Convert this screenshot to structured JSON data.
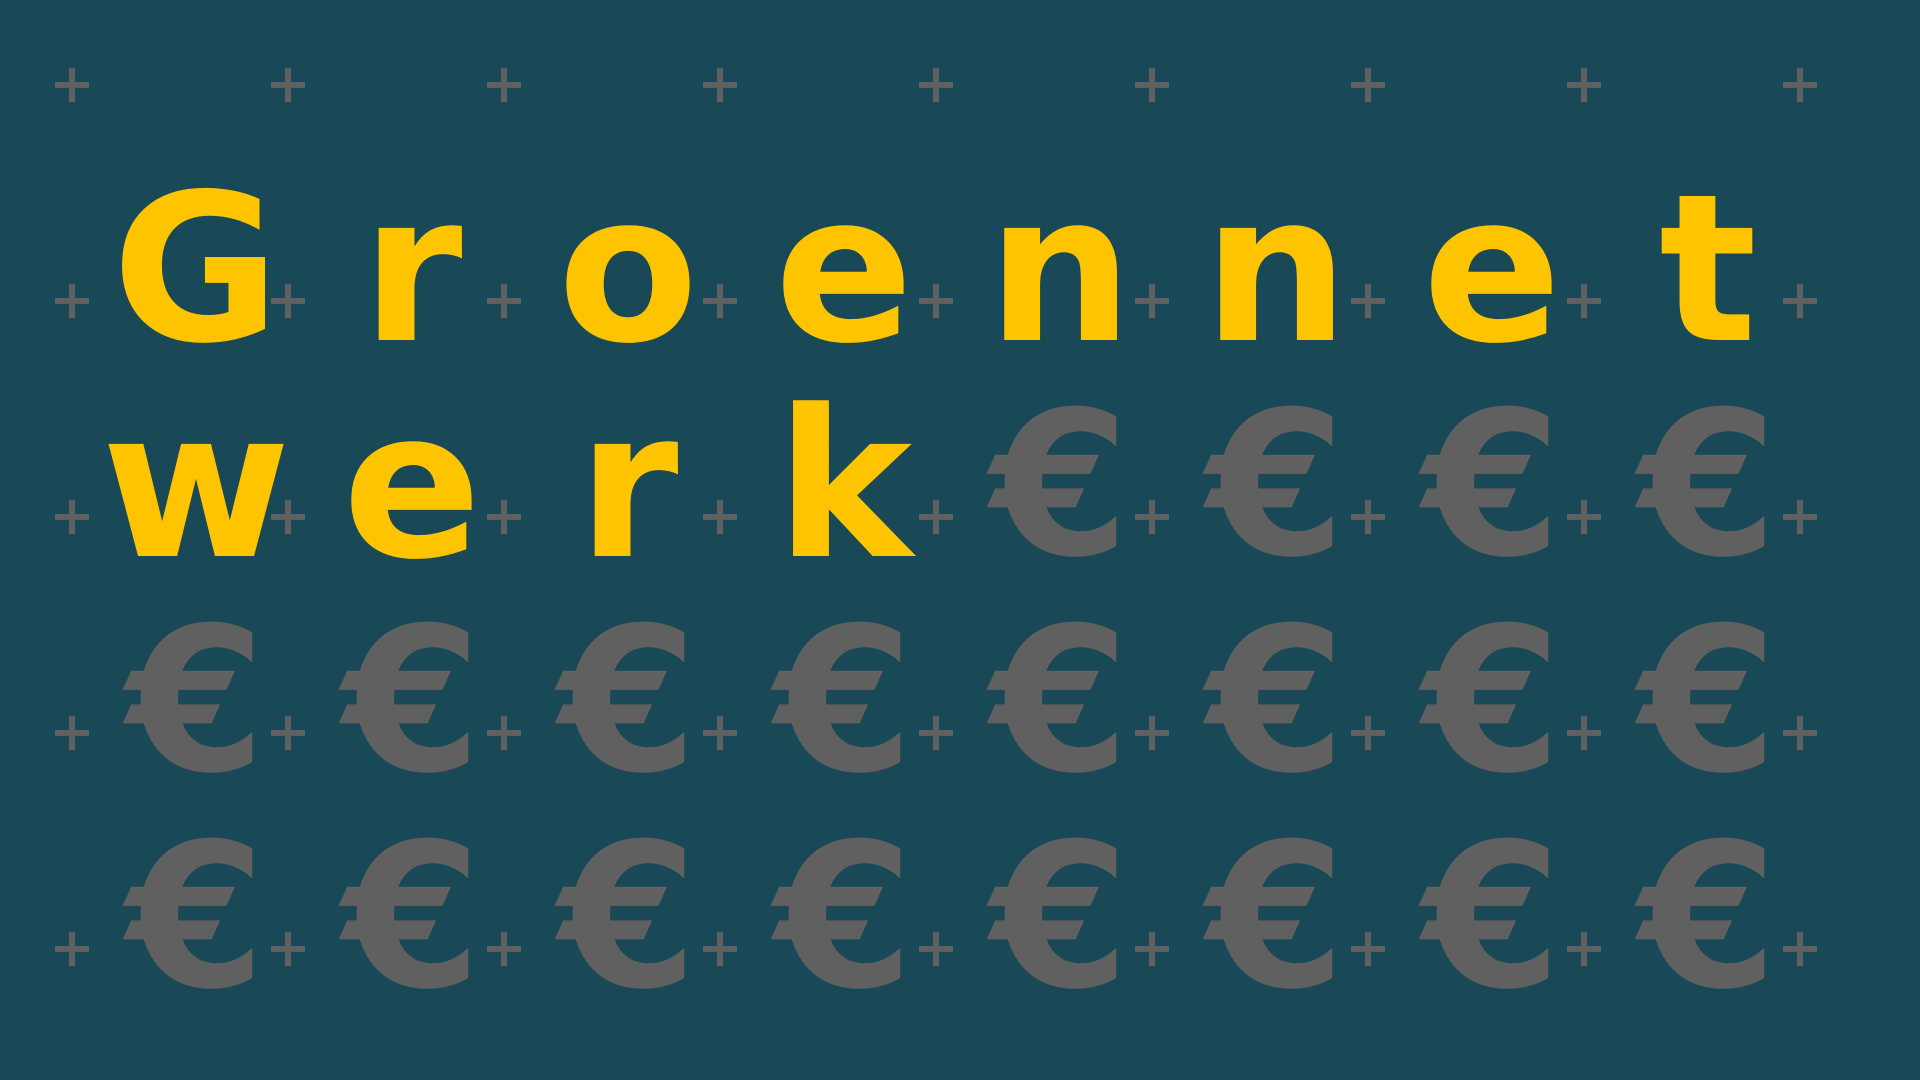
{
  "background_color": "#194856",
  "title": {
    "text": "Groennetwerk",
    "color": "#FFC400",
    "letters": [
      "G",
      "r",
      "o",
      "e",
      "n",
      "n",
      "e",
      "t",
      "w",
      "e",
      "r",
      "k"
    ]
  },
  "symbol": {
    "glyph": "€",
    "color": "#606060",
    "count": 20
  },
  "decoration": {
    "name": "plus-icon",
    "color": "#606060"
  }
}
